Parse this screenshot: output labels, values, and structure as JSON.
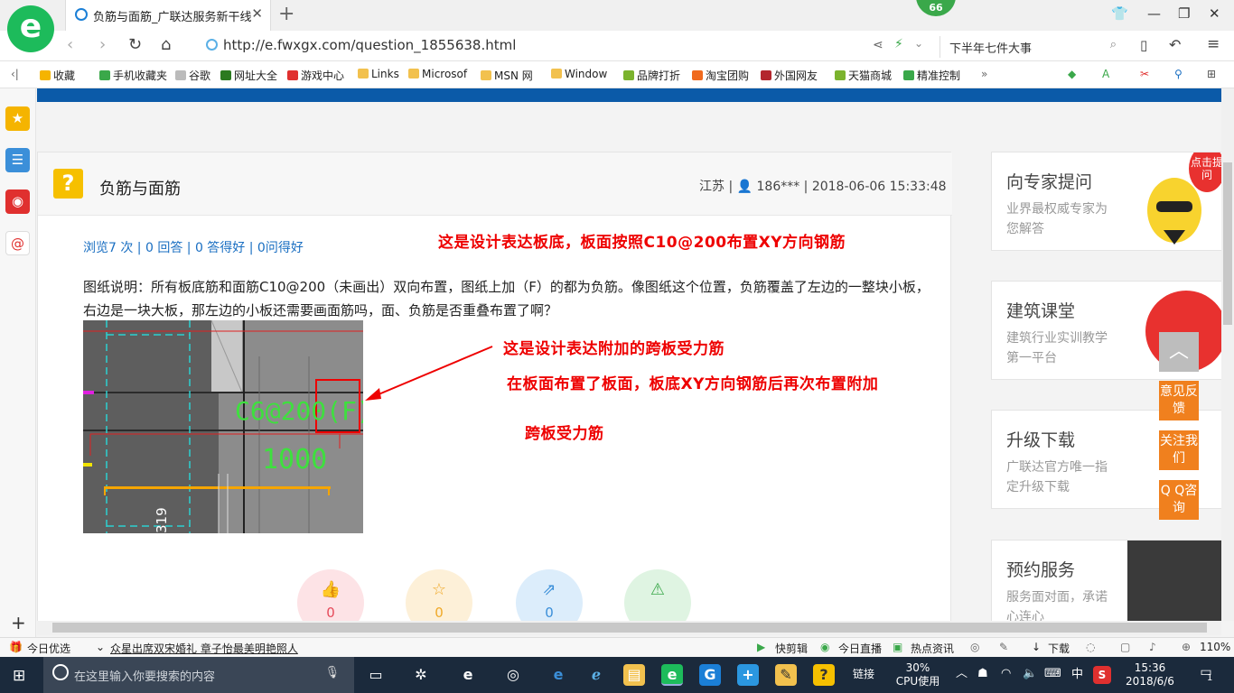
{
  "browser": {
    "tab_title": "负筋与面筋_广联达服务新干线",
    "badge_count": "66",
    "url": "http://e.fwxgx.com/question_1855638.html",
    "hot_search": "下半年七件大事"
  },
  "bookmarks": [
    {
      "label": "收藏",
      "icon": "star-icon",
      "color": "#f5b400"
    },
    {
      "label": "手机收藏夹",
      "icon": "phone-icon",
      "color": "#3aa84a"
    },
    {
      "label": "谷歌",
      "icon": "page-icon",
      "color": "#bbbbbb"
    },
    {
      "label": "网址大全",
      "icon": "globe-icon",
      "color": "#2b7a1f"
    },
    {
      "label": "游戏中心",
      "icon": "game-icon",
      "color": "#e0302f"
    },
    {
      "label": "Links",
      "icon": "folder-icon",
      "color": "#f2c14e"
    },
    {
      "label": "Microsof",
      "icon": "folder-icon",
      "color": "#f2c14e"
    },
    {
      "label": "MSN 网",
      "icon": "folder-icon",
      "color": "#f2c14e"
    },
    {
      "label": "Window",
      "icon": "folder-icon",
      "color": "#f2c14e"
    },
    {
      "label": "品牌打折",
      "icon": "leaf-icon",
      "color": "#7bb32e"
    },
    {
      "label": "淘宝团购",
      "icon": "taobao-icon",
      "color": "#f06a1e"
    },
    {
      "label": "外国网友",
      "icon": "bookmark-icon",
      "color": "#b3262d"
    },
    {
      "label": "天猫商城",
      "icon": "leaf-icon",
      "color": "#7bb32e"
    },
    {
      "label": "精准控制",
      "icon": "chat-icon",
      "color": "#3aa84a"
    }
  ],
  "question": {
    "title": "负筋与面筋",
    "meta": "江苏 | 👤 186*** | 2018-06-06 15:33:48",
    "stats": "浏览7 次 | 0 回答 | 0 答得好 | 0问得好",
    "description": "图纸说明：所有板底筋和面筋C10@200（未画出）双向布置，图纸上加（F）的都为负筋。像图纸这个位置，负筋覆盖了左边的一整块小板，右边是一块大板，那左边的小板还需要画面筋吗，面、负筋是否重叠布置了啊？",
    "cad_labels": {
      "rebar": "C6@200(F)",
      "length": "1000",
      "dim": "319"
    },
    "actions": [
      {
        "name": "like",
        "icon": "thumbs-up-icon",
        "count": "0",
        "color": "#e64a5a",
        "bg": "#fde3e6"
      },
      {
        "name": "favorite",
        "icon": "star-outline-icon",
        "count": "0",
        "color": "#f0a928",
        "bg": "#fdf0d8"
      },
      {
        "name": "share",
        "icon": "share-icon",
        "count": "0",
        "color": "#3b8fd9",
        "bg": "#dcedfb"
      },
      {
        "name": "report",
        "icon": "warning-icon",
        "count": "",
        "color": "#3aa84a",
        "bg": "#dff4e2"
      }
    ]
  },
  "annotations": {
    "a1": "这是设计表达板底，板面按照C10@200布置XY方向钢筋",
    "a2": "这是设计表达附加的跨板受力筋",
    "a3": "在板面布置了板面，板底XY方向钢筋后再次布置附加",
    "a4": "跨板受力筋"
  },
  "sidebar_cards": [
    {
      "title": "向专家提问",
      "sub": "业界最权威专家为您解答",
      "tag": "点击提问"
    },
    {
      "title": "建筑课堂",
      "sub": "建筑行业实训教学第一平台"
    },
    {
      "title": "升级下载",
      "sub": "广联达官方唯一指定升级下载"
    },
    {
      "title": "预约服务",
      "sub": "服务面对面，承诺心连心"
    }
  ],
  "floating": {
    "feedback": "意见反馈",
    "follow": "关注我们",
    "qq": "Q Q咨询"
  },
  "statusbar": {
    "today": "今日优选",
    "news": "众星出席双宋婚礼 章子怡最美明艳照人",
    "clip": "快剪辑",
    "live": "今日直播",
    "hot": "热点资讯",
    "download": "下载",
    "zoom": "110%"
  },
  "taskbar": {
    "search_placeholder": "在这里输入你要搜索的内容",
    "links": "链接",
    "cpu": "30%",
    "cpu_label": "CPU使用",
    "ime": "中",
    "time": "15:36",
    "date": "2018/6/6",
    "notifications": "1"
  }
}
